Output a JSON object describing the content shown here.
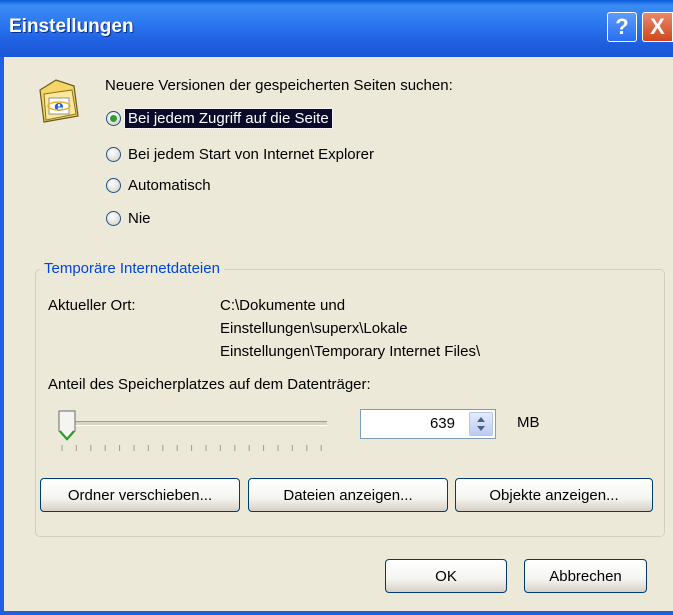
{
  "window": {
    "title": "Einstellungen",
    "help_label": "?",
    "close_label": "X",
    "colors": {
      "titlebar": "#1f5fe0",
      "face": "#ece9d8",
      "group_title": "#0046d5",
      "radio_dot": "#21a121"
    }
  },
  "check": {
    "heading": "Neuere Versionen der gespeicherten Seiten suchen:",
    "options": [
      {
        "label": "Bei jedem Zugriff auf die Seite",
        "selected": true
      },
      {
        "label": "Bei jedem Start von Internet Explorer",
        "selected": false
      },
      {
        "label": "Automatisch",
        "selected": false
      },
      {
        "label": "Nie",
        "selected": false
      }
    ]
  },
  "temp": {
    "group_title": "Temporäre Internetdateien",
    "location_label": "Aktueller Ort:",
    "location_lines": [
      "C:\\Dokumente und",
      "Einstellungen\\superx\\Lokale",
      "Einstellungen\\Temporary Internet Files\\"
    ],
    "space_label": "Anteil des Speicherplatzes auf dem Datenträger:",
    "space_value": "639",
    "space_unit": "MB",
    "slider_level": 0.02,
    "buttons": {
      "move": "Ordner verschieben...",
      "files": "Dateien anzeigen...",
      "objects": "Objekte anzeigen..."
    }
  },
  "footer": {
    "ok": "OK",
    "cancel": "Abbrechen"
  },
  "icons": [
    "ie-folder-icon",
    "help-icon",
    "close-icon",
    "slider-thumb-icon",
    "spin-arrows-icon"
  ]
}
